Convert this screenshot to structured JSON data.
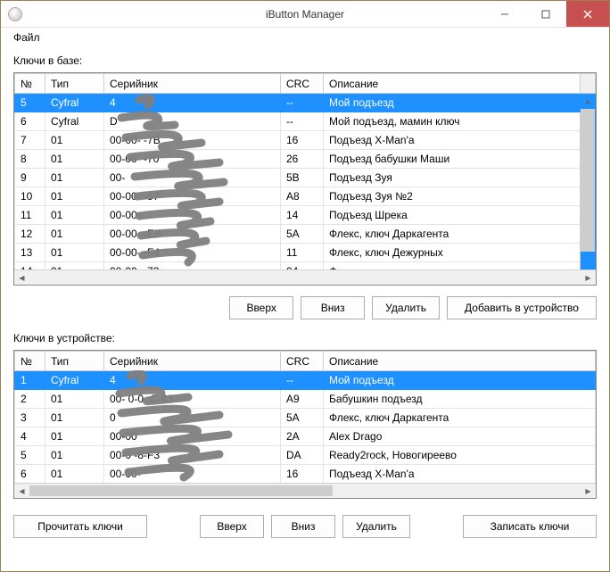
{
  "window": {
    "title": "iButton Manager"
  },
  "menu": {
    "file": "Файл"
  },
  "labels": {
    "keys_in_db": "Ключи в базе:",
    "keys_in_device": "Ключи в устройстве:"
  },
  "columns": {
    "no": "№",
    "type": "Тип",
    "serial": "Серийник",
    "crc": "CRC",
    "desc": "Описание"
  },
  "buttons": {
    "up": "Вверх",
    "down": "Вниз",
    "delete": "Удалить",
    "add_to_device": "Добавить в устройство",
    "read_keys": "Прочитать ключи",
    "write_keys": "Записать ключи"
  },
  "db_rows": [
    {
      "no": "5",
      "type": "Cyfral",
      "serial": "4",
      "crc": "--",
      "desc": "Мой подъезд",
      "selected": true
    },
    {
      "no": "6",
      "type": "Cyfral",
      "serial": "        D",
      "crc": "--",
      "desc": "Мой подъезд, мамин ключ"
    },
    {
      "no": "7",
      "type": "01",
      "serial": "00-00-          -7B",
      "crc": "16",
      "desc": "Подъезд X-Man'а"
    },
    {
      "no": "8",
      "type": "01",
      "serial": "00-00-         -70",
      "crc": "26",
      "desc": "Подъезд бабушки Маши"
    },
    {
      "no": "9",
      "type": "01",
      "serial": "00-               ",
      "crc": "5B",
      "desc": "Подъезд Зуя"
    },
    {
      "no": "10",
      "type": "01",
      "serial": "00-00-        -57",
      "crc": "A8",
      "desc": "Подъезд Зуя №2"
    },
    {
      "no": "11",
      "type": "01",
      "serial": "00-00-             ",
      "crc": "14",
      "desc": "Подъезд Шрека"
    },
    {
      "no": "12",
      "type": "01",
      "serial": "00-00-        -EB",
      "crc": "5A",
      "desc": "Флекс, ключ Даркагента"
    },
    {
      "no": "13",
      "type": "01",
      "serial": "00-00-        -F4",
      "crc": "11",
      "desc": "Флекс, ключ Дежурных"
    },
    {
      "no": "14",
      "type": "01",
      "serial": "00-00-        -73",
      "crc": "04",
      "desc": "Ф"
    }
  ],
  "dev_rows": [
    {
      "no": "1",
      "type": "Cyfral",
      "serial": "4",
      "crc": "--",
      "desc": "Мой подъезд",
      "selected": true
    },
    {
      "no": "2",
      "type": "01",
      "serial": "00-  0-0      -C-63",
      "crc": "A9",
      "desc": "Бабушкин подъезд"
    },
    {
      "no": "3",
      "type": "01",
      "serial": "0                  ",
      "crc": "5A",
      "desc": "Флекс, ключ Даркагента"
    },
    {
      "no": "4",
      "type": "01",
      "serial": "00-00              ",
      "crc": "2A",
      "desc": "Alex Drago"
    },
    {
      "no": "5",
      "type": "01",
      "serial": "00-0          -8-F3",
      "crc": "DA",
      "desc": "Ready2rock, Новогиреево"
    },
    {
      "no": "6",
      "type": "01",
      "serial": "00-00-             ",
      "crc": "16",
      "desc": "Подъезд X-Man'а"
    }
  ]
}
